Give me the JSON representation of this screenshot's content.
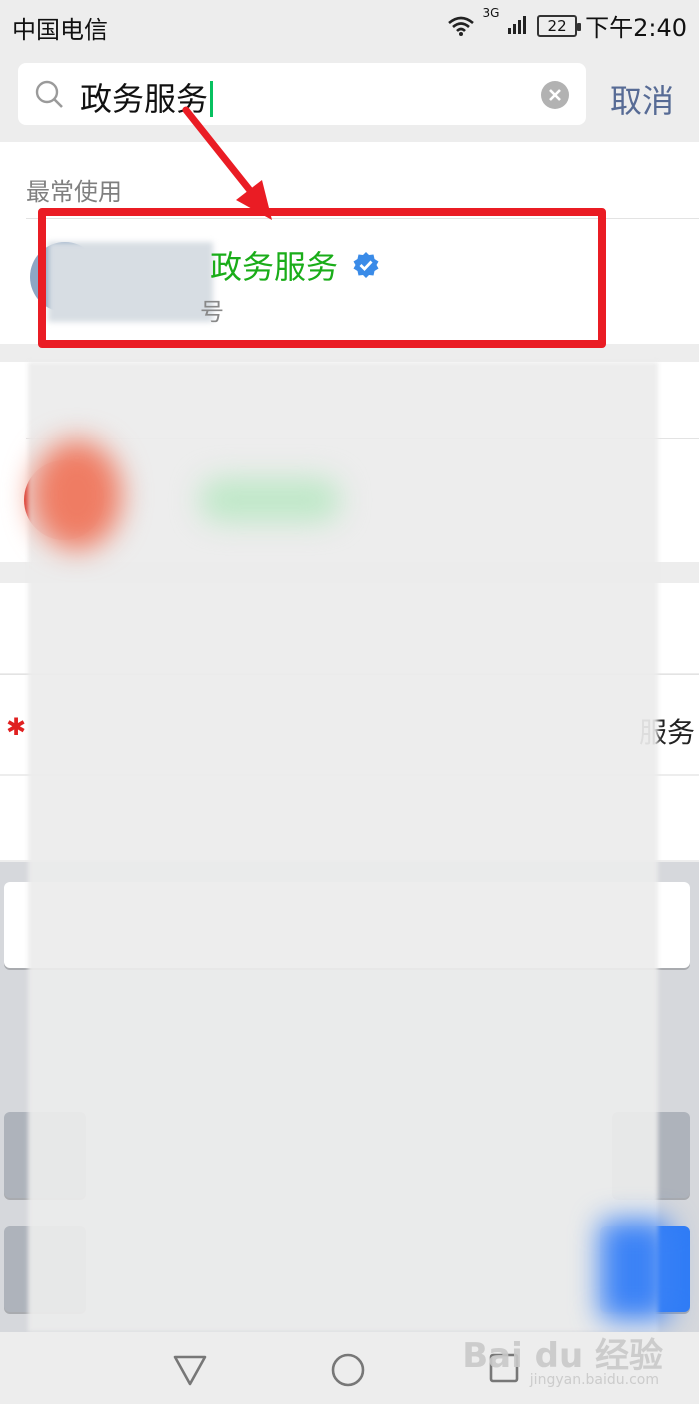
{
  "status_bar": {
    "carrier": "中国电信",
    "network": "3G",
    "battery": "22",
    "time": "下午2:40"
  },
  "search": {
    "query": "政务服务",
    "cancel_label": "取消"
  },
  "most_used": {
    "section_title": "最常使用",
    "result": {
      "name": "政务服务",
      "subtitle": "号"
    }
  },
  "partial_row": {
    "text": "服务"
  },
  "watermark": {
    "brand": "Bai du 经验",
    "url": "jingyan.baidu.com"
  },
  "colors": {
    "highlight": "#ea1c24",
    "accent_green": "#1aad19",
    "cancel_blue": "#576b95",
    "verify_blue": "#3a8be8"
  },
  "icons": {
    "search": "search-icon",
    "clear": "clear-icon",
    "verified": "verified-badge-icon",
    "back": "nav-back-icon",
    "home": "nav-home-icon",
    "recent": "nav-recent-icon"
  }
}
